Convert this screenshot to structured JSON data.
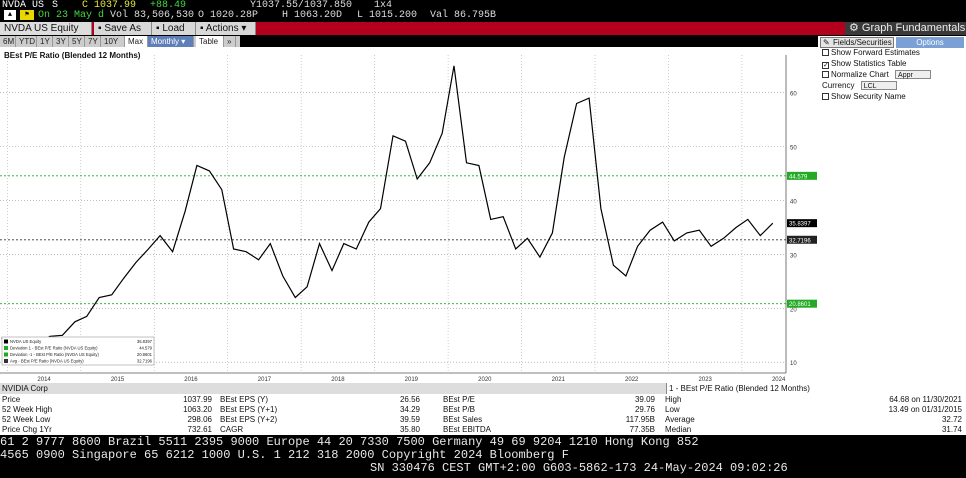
{
  "ticker": {
    "symbol": "NVDA US",
    "flag": "S",
    "price": "C 1037.99",
    "change": "+88.49",
    "bid_ask": "Y1037.55/1037.850",
    "size": "1x4",
    "date": "On 23 May d",
    "volume": "Vol 83,506,530",
    "open": "O 1020.28P",
    "high": "H 1063.20D",
    "low": "L 1015.200",
    "val": "Val 86.795B"
  },
  "toolbar": {
    "security": "NVDA US Equity",
    "save_as": "Save As",
    "load": "Load",
    "actions": "Actions",
    "title": "Graph Fundamentals"
  },
  "range_tabs": [
    "6M",
    "YTD",
    "1Y",
    "3Y",
    "5Y",
    "7Y",
    "10Y",
    "Max",
    "Monthly",
    "Table"
  ],
  "chart_data": {
    "type": "line",
    "title": "BEst P/E Ratio (Blended 12 Months)",
    "x_ticks": [
      "2014",
      "2015",
      "2016",
      "2017",
      "2018",
      "2019",
      "2020",
      "2021",
      "2022",
      "2023",
      "2024"
    ],
    "y_ticks": [
      10,
      20,
      30,
      40,
      50,
      60
    ],
    "ylim": [
      8,
      67
    ],
    "xlim": [
      2013.9,
      2024.6
    ],
    "grid": true,
    "series": [
      {
        "name": "BEst P/E Ratio (NVDA US Equity)",
        "x": [
          2013.92,
          2014.08,
          2014.25,
          2014.42,
          2014.58,
          2014.75,
          2014.92,
          2015.08,
          2015.25,
          2015.42,
          2015.58,
          2015.75,
          2015.92,
          2016.08,
          2016.25,
          2016.42,
          2016.58,
          2016.75,
          2016.92,
          2017.08,
          2017.25,
          2017.42,
          2017.58,
          2017.75,
          2017.92,
          2018.08,
          2018.25,
          2018.42,
          2018.58,
          2018.75,
          2018.92,
          2019.08,
          2019.25,
          2019.42,
          2019.58,
          2019.75,
          2019.92,
          2020.08,
          2020.25,
          2020.42,
          2020.58,
          2020.75,
          2020.92,
          2021.08,
          2021.25,
          2021.42,
          2021.58,
          2021.75,
          2021.92,
          2022.08,
          2022.25,
          2022.42,
          2022.58,
          2022.75,
          2022.92,
          2023.08,
          2023.25,
          2023.42,
          2023.58,
          2023.75,
          2023.92,
          2024.08,
          2024.25,
          2024.42
        ],
        "values": [
          14.5,
          13.8,
          13.7,
          13.5,
          14.8,
          15.0,
          17.5,
          18.5,
          22.0,
          22.5,
          25.5,
          28.5,
          31.0,
          33.5,
          30.5,
          38.0,
          46.5,
          45.5,
          42.0,
          31.0,
          30.5,
          29.0,
          32.0,
          26.0,
          22.0,
          24.0,
          32.0,
          27.0,
          32.0,
          31.0,
          36.0,
          38.5,
          52.0,
          51.0,
          44.0,
          47.0,
          52.5,
          65.0,
          47.0,
          46.5,
          36.5,
          37.0,
          31.0,
          33.0,
          29.5,
          34.0,
          48.0,
          58.0,
          59.0,
          38.5,
          28.0,
          26.0,
          31.5,
          34.5,
          36.0,
          32.5,
          34.0,
          34.5,
          31.5,
          33.0,
          35.0,
          36.5,
          33.5,
          35.8
        ],
        "color": "#000000"
      }
    ],
    "reference_lines": [
      {
        "label": "Deviation 1",
        "value": 44.579,
        "color": "#22aa22",
        "style": "dashed"
      },
      {
        "label": "Average",
        "value": 32.7196,
        "color": "#333333",
        "style": "dashed"
      },
      {
        "label": "Deviation -1",
        "value": 20.8601,
        "color": "#22aa22",
        "style": "dashed"
      }
    ],
    "last_value_tag": "35.8397",
    "legend": [
      {
        "label": "NVDA US Equity",
        "value": "35.8397"
      },
      {
        "label": "Deviation 1 - BEst P/E Ratio (NVDA US Equity)",
        "value": "44.579"
      },
      {
        "label": "Deviation -1 - BEst P/E Ratio (NVDA US Equity)",
        "value": "20.8601"
      },
      {
        "label": "Avg - BEst P/E Ratio (NVDA US Equity)",
        "value": "32.7196"
      }
    ],
    "legend_placement": "bottom-left"
  },
  "options": {
    "fields_button": "Fields/Securities",
    "options_button": "Options",
    "show_forward": "Show Forward Estimates",
    "show_statistics": "Show Statistics Table",
    "normalize": "Normalize Chart",
    "normalize_value": "Appr",
    "currency_label": "Currency",
    "currency_value": "LCL",
    "show_security": "Show Security Name"
  },
  "corp_bar": {
    "left": "NVIDIA Corp",
    "right": "1 - BEst P/E Ratio (Blended 12 Months)"
  },
  "stats": {
    "col1": [
      {
        "label": "Price",
        "value": "1037.99"
      },
      {
        "label": "52 Week High",
        "value": "1063.20"
      },
      {
        "label": "52 Week Low",
        "value": "298.06"
      },
      {
        "label": "Price Chg 1Yr",
        "value": "732.61"
      }
    ],
    "col2": [
      {
        "label": "BEst EPS (Y)",
        "value": "26.56"
      },
      {
        "label": "BEst EPS (Y+1)",
        "value": "34.29"
      },
      {
        "label": "BEst EPS (Y+2)",
        "value": "39.59"
      },
      {
        "label": "CAGR",
        "value": "35.80"
      }
    ],
    "col3": [
      {
        "label": "BEst P/E",
        "value": "39.09"
      },
      {
        "label": "BEst P/B",
        "value": "29.76"
      },
      {
        "label": "BEst Sales",
        "value": "117.95B"
      },
      {
        "label": "BEst EBITDA",
        "value": "77.35B"
      }
    ],
    "col4": [
      {
        "label": "High",
        "value": "64.68 on 11/30/2021"
      },
      {
        "label": "Low",
        "value": "13.49 on 01/31/2015"
      },
      {
        "label": "Average",
        "value": "32.72"
      },
      {
        "label": "Median",
        "value": "31.74"
      }
    ]
  },
  "footer": {
    "line1": "61 2 9777 8600 Brazil 5511 2395 9000 Europe 44 20 7330 7500 Germany 49 69 9204 1210 Hong Kong 852",
    "line2": "4565 0900         Singapore 65 6212 1000       U.S. 1 212 318 2000          Copyright 2024 Bloomberg F",
    "line3": "SN 330476 CEST GMT+2:00 G603-5862-173 24-May-2024 09:02:26"
  }
}
